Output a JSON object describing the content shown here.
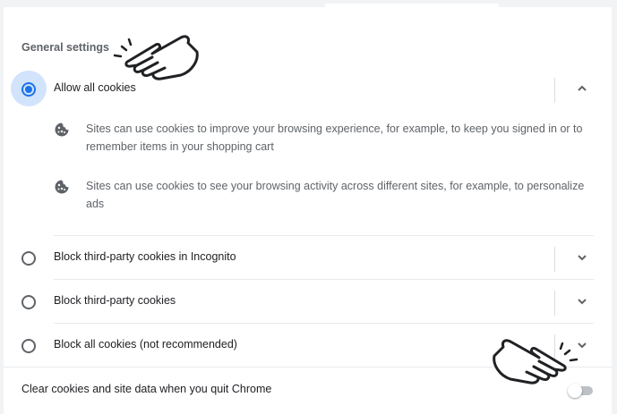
{
  "section": {
    "title": "General settings"
  },
  "options": [
    {
      "label": "Allow all cookies",
      "checked": true,
      "expanded": true
    },
    {
      "label": "Block third-party cookies in Incognito",
      "checked": false,
      "expanded": false
    },
    {
      "label": "Block third-party cookies",
      "checked": false,
      "expanded": false
    },
    {
      "label": "Block all cookies (not recommended)",
      "checked": false,
      "expanded": false
    }
  ],
  "details": [
    {
      "text": "Sites can use cookies to improve your browsing experience, for example, to keep you signed in or to remember items in your shopping cart",
      "icon": "cookie-icon"
    },
    {
      "text": "Sites can use cookies to see your browsing activity across different sites, for example, to personalize ads",
      "icon": "cookie-icon"
    }
  ],
  "clear_on_exit": {
    "label": "Clear cookies and site data when you quit Chrome",
    "enabled": false
  },
  "colors": {
    "accent": "#1a73e8",
    "text": "#202124",
    "secondary": "#5f6368",
    "halo": "#d2e3fc"
  },
  "annotations": [
    "pointing-hand-icon",
    "pointing-hand-icon"
  ]
}
